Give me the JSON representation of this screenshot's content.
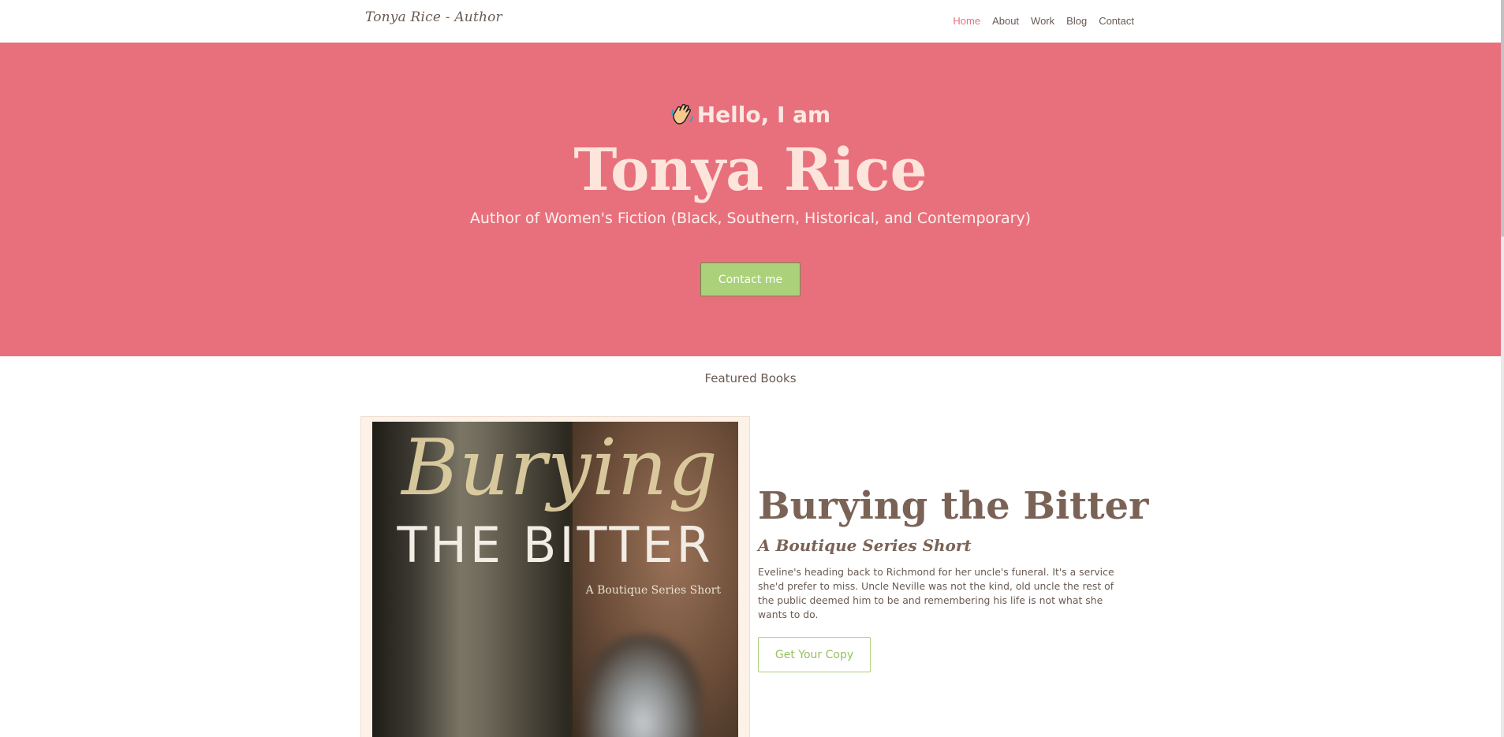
{
  "navbar": {
    "brand": "Tonya Rice  - Author",
    "links": [
      {
        "label": "Home",
        "active": true
      },
      {
        "label": "About",
        "active": false
      },
      {
        "label": "Work",
        "active": false
      },
      {
        "label": "Blog",
        "active": false
      },
      {
        "label": "Contact",
        "active": false
      }
    ]
  },
  "hero": {
    "greeting_icon": "waving-hand-icon",
    "greeting": "Hello, I am",
    "name": "Tonya Rice",
    "subtitle": "Author of Women's Fiction (Black, Southern, Historical, and Contemporary)",
    "cta_label": "Contact me"
  },
  "featured": {
    "section_title": "Featured Books",
    "book": {
      "cover": {
        "script_text": "Burying",
        "title_text": "THE BITTER",
        "series_text": "A Boutique Series Short"
      },
      "title": "Burying the Bitter",
      "subtitle": "A Boutique Series Short",
      "description": "Eveline's heading back to Richmond for her uncle's funeral. It's a service she'd prefer to miss. Uncle Neville was not the kind, old uncle the rest of the public deemed him to be and remembering his life is not what she wants to do.",
      "cta_label": "Get Your Copy"
    }
  },
  "colors": {
    "hero_bg": "#e8707d",
    "accent_green": "#abd17a",
    "text_brown": "#7a6356",
    "nav_active": "#e8707d"
  }
}
